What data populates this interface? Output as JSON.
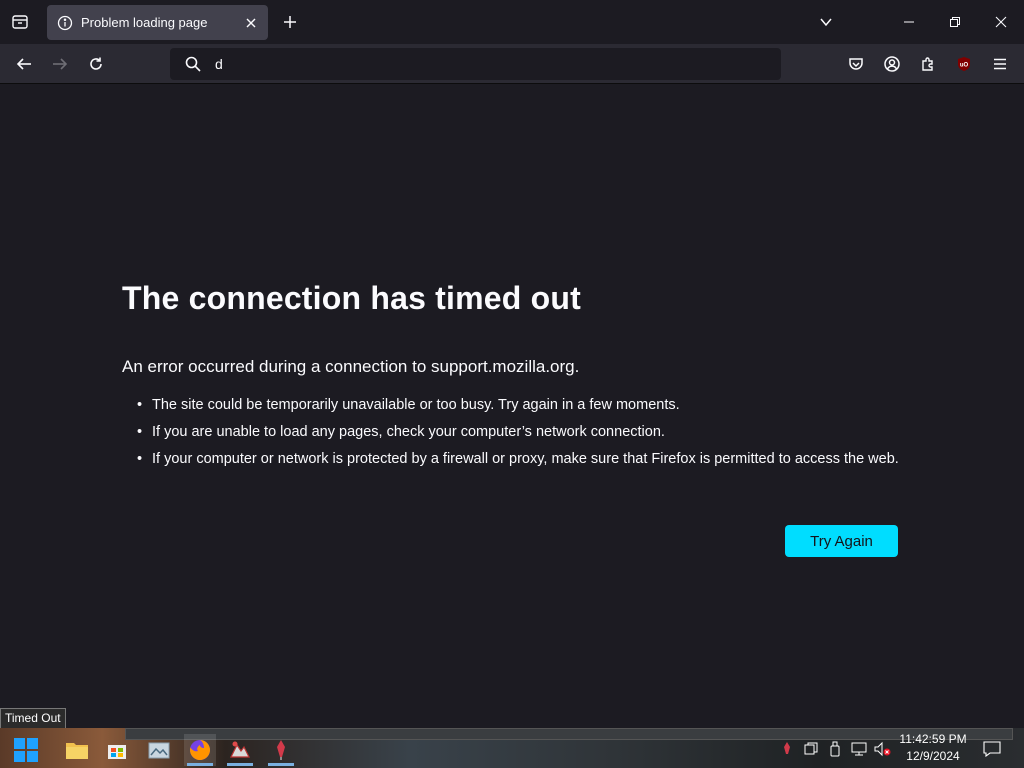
{
  "browser": {
    "tab": {
      "title": "Problem loading page"
    },
    "address_bar": {
      "value": "d"
    }
  },
  "error_page": {
    "title": "The connection has timed out",
    "description": "An error occurred during a connection to support.mozilla.org.",
    "suggestions": [
      "The site could be temporarily unavailable or too busy. Try again in a few moments.",
      "If you are unable to load any pages, check your computer’s network connection.",
      "If your computer or network is protected by a firewall or proxy, make sure that Firefox is permitted to access the web."
    ],
    "try_again_label": "Try Again"
  },
  "tooltip": {
    "text": "Timed Out"
  },
  "taskbar": {
    "time": "11:42:59 PM",
    "date": "12/9/2024",
    "apps": [
      "start-icon",
      "file-explorer-icon",
      "store-icon",
      "photo-app-icon",
      "firefox-icon",
      "paint-app-icon",
      "pen-app-icon"
    ]
  },
  "colors": {
    "accent": "#00ddff",
    "background": "#1c1b22",
    "toolbar": "#2b2a33",
    "text": "#fbfbfe"
  }
}
